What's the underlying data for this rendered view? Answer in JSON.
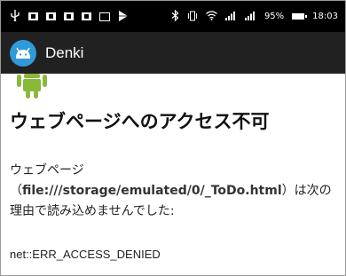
{
  "status_bar": {
    "battery_text": "95%",
    "time": "18:03"
  },
  "app_bar": {
    "title": "Denki",
    "logo_icon": "android-robot-icon",
    "logo_color": "#2f9ad8"
  },
  "error_page": {
    "mascot_icon": "android-mascot-icon",
    "mascot_color": "#8ab83a",
    "heading": "ウェブページへのアクセス不可",
    "message_line1": "ウェブページ",
    "message_url_prefix": "（",
    "message_url": "file:///storage/emulated/0/_ToDo.html",
    "message_url_suffix": "）は次の理由で読み込めませんでした:",
    "error_code": "net::ERR_ACCESS_DENIED"
  }
}
